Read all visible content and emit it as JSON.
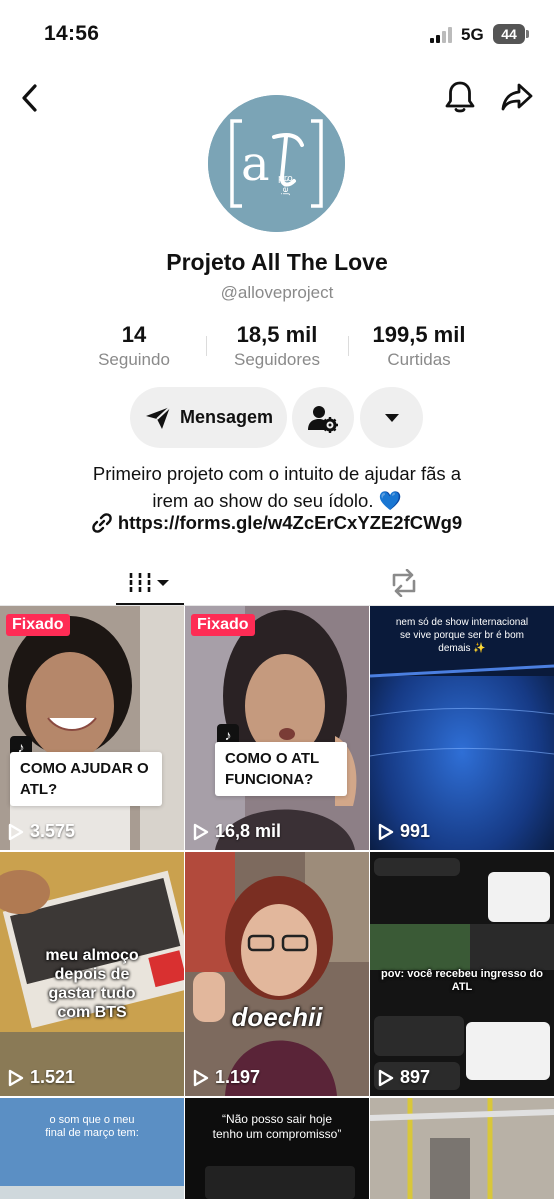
{
  "status_bar": {
    "time": "14:56",
    "network": "5G",
    "battery": "44"
  },
  "profile": {
    "name": "Projeto All The Love",
    "handle": "@alloveproject",
    "avatar_text": "ATL project",
    "stats": [
      {
        "value": "14",
        "label": "Seguindo"
      },
      {
        "value": "18,5 mil",
        "label": "Seguidores"
      },
      {
        "value": "199,5 mil",
        "label": "Curtidas"
      }
    ],
    "message_button": "Mensagem",
    "bio_line1": "Primeiro projeto com o intuito de ajudar fãs a",
    "bio_line2": "irem ao show do seu ídolo. 💙",
    "link": "https://forms.gle/w4ZcErCxYZE2fCWg9"
  },
  "videos": [
    {
      "pinned": "Fixado",
      "caption": "COMO AJUDAR O ATL?",
      "views": "3.575"
    },
    {
      "pinned": "Fixado",
      "caption": "COMO O ATL FUNCIONA?",
      "views": "16,8 mil"
    },
    {
      "overlay": "nem só de show internacional se vive porque ser br é bom demais ✨",
      "views": "991"
    },
    {
      "overlay": "meu almoço depois de gastar tudo com BTS",
      "views": "1.521"
    },
    {
      "overlay": "doechii",
      "views": "1.197"
    },
    {
      "overlay": "pov: você recebeu ingresso do ATL",
      "views": "897"
    },
    {
      "overlay": "o som que o meu final de março tem:"
    },
    {
      "overlay": "“Não posso sair hoje tenho um compromisso”"
    },
    {
      "overlay": ""
    }
  ],
  "colors": {
    "accent": "#fe2c55",
    "avatar_bg": "#7ba4b6",
    "button_bg": "#efefef",
    "muted_text": "#8a8a8a"
  }
}
